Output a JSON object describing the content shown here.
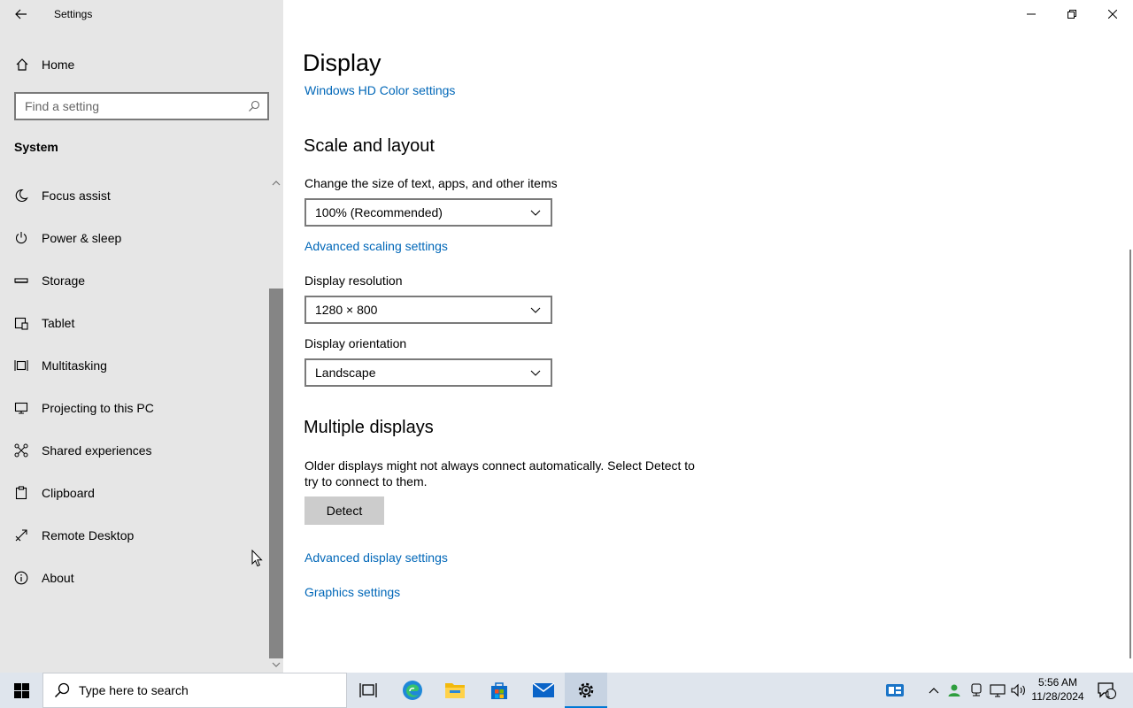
{
  "window": {
    "title": "Settings"
  },
  "sidebar": {
    "home_label": "Home",
    "search_placeholder": "Find a setting",
    "section_title": "System",
    "items": [
      {
        "label": "Focus assist",
        "icon": "moon-icon"
      },
      {
        "label": "Power & sleep",
        "icon": "power-icon"
      },
      {
        "label": "Storage",
        "icon": "storage-icon"
      },
      {
        "label": "Tablet",
        "icon": "tablet-icon"
      },
      {
        "label": "Multitasking",
        "icon": "multitasking-icon"
      },
      {
        "label": "Projecting to this PC",
        "icon": "projecting-icon"
      },
      {
        "label": "Shared experiences",
        "icon": "shared-experiences-icon"
      },
      {
        "label": "Clipboard",
        "icon": "clipboard-icon"
      },
      {
        "label": "Remote Desktop",
        "icon": "remote-desktop-icon"
      },
      {
        "label": "About",
        "icon": "info-icon"
      }
    ]
  },
  "main": {
    "page_title": "Display",
    "hd_color_link": "Windows HD Color settings",
    "scale_section": {
      "heading": "Scale and layout",
      "scale_label": "Change the size of text, apps, and other items",
      "scale_value": "100% (Recommended)",
      "advanced_scaling_link": "Advanced scaling settings",
      "resolution_label": "Display resolution",
      "resolution_value": "1280 × 800",
      "orientation_label": "Display orientation",
      "orientation_value": "Landscape"
    },
    "multiple_displays": {
      "heading": "Multiple displays",
      "description": "Older displays might not always connect automatically. Select Detect to try to connect to them.",
      "detect_button": "Detect",
      "advanced_display_link": "Advanced display settings",
      "graphics_link": "Graphics settings"
    }
  },
  "taskbar": {
    "search_placeholder": "Type here to search",
    "apps": [
      "task-view-icon",
      "edge-icon",
      "file-explorer-icon",
      "store-icon",
      "mail-icon",
      "settings-icon"
    ],
    "clock_time": "5:56 AM",
    "clock_date": "11/28/2024",
    "notification_count": "1"
  },
  "colors": {
    "accent": "#0067b8",
    "sidebar_bg": "#e6e6e6",
    "taskbar_bg": "#dfe5ed"
  }
}
